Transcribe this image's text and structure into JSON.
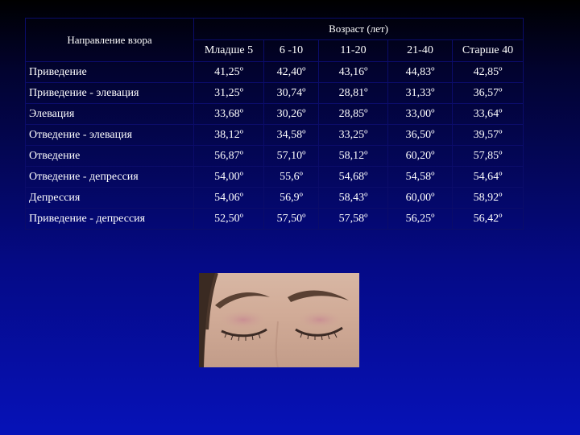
{
  "table": {
    "direction_header": "Направление взора",
    "age_header": "Возраст (лет)",
    "age_columns": [
      "Младше 5",
      "6 -10",
      "11-20",
      "21-40",
      "Старше 40"
    ],
    "rows": [
      {
        "label": "Приведение",
        "values": [
          "41,25º",
          "42,40º",
          "43,16º",
          "44,83º",
          "42,85º"
        ]
      },
      {
        "label": "Приведение - элевация",
        "values": [
          "31,25º",
          "30,74º",
          "28,81º",
          "31,33º",
          "36,57º"
        ]
      },
      {
        "label": "Элевация",
        "values": [
          "33,68º",
          "30,26º",
          "28,85º",
          "33,00º",
          "33,64º"
        ]
      },
      {
        "label": "Отведение - элевация",
        "values": [
          "38,12º",
          "34,58º",
          "33,25º",
          "36,50º",
          "39,57º"
        ]
      },
      {
        "label": "Отведение",
        "values": [
          "56,87º",
          "57,10º",
          "58,12º",
          "60,20º",
          "57,85º"
        ]
      },
      {
        "label": "Отведение - депрессия",
        "values": [
          "54,00º",
          "55,6º",
          "54,68º",
          "54,58º",
          "54,64º"
        ]
      },
      {
        "label": "Депрессия",
        "values": [
          "54,06º",
          "56,9º",
          "58,43º",
          "60,00º",
          "58,92º"
        ]
      },
      {
        "label": "Приведение - депрессия",
        "values": [
          "52,50º",
          "57,50º",
          "57,58º",
          "56,25º",
          "56,42º"
        ]
      }
    ]
  },
  "photo": {
    "icon": "closed-eyes-photo"
  }
}
